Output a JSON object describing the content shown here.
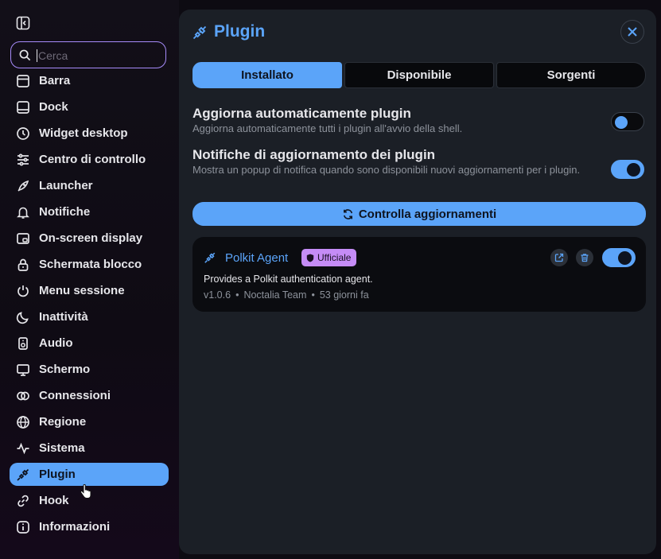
{
  "search": {
    "placeholder": "Cerca"
  },
  "sidebar": {
    "items": [
      {
        "label": "Barra"
      },
      {
        "label": "Dock"
      },
      {
        "label": "Widget desktop"
      },
      {
        "label": "Centro di controllo"
      },
      {
        "label": "Launcher"
      },
      {
        "label": "Notifiche"
      },
      {
        "label": "On-screen display"
      },
      {
        "label": "Schermata blocco"
      },
      {
        "label": "Menu sessione"
      },
      {
        "label": "Inattività"
      },
      {
        "label": "Audio"
      },
      {
        "label": "Schermo"
      },
      {
        "label": "Connessioni"
      },
      {
        "label": "Regione"
      },
      {
        "label": "Sistema"
      },
      {
        "label": "Plugin"
      },
      {
        "label": "Hook"
      },
      {
        "label": "Informazioni"
      }
    ]
  },
  "panel": {
    "title": "Plugin",
    "tabs": [
      "Installato",
      "Disponibile",
      "Sorgenti"
    ],
    "settings": [
      {
        "title": "Aggiorna automaticamente plugin",
        "description": "Aggiorna automaticamente tutti i plugin all'avvio della shell.",
        "enabled": false
      },
      {
        "title": "Notifiche di aggiornamento dei plugin",
        "description": "Mostra un popup di notifica quando sono disponibili nuovi aggiornamenti per i plugin.",
        "enabled": true
      }
    ],
    "check_button": "Controlla aggiornamenti",
    "plugin": {
      "name": "Polkit Agent",
      "badge": "Ufficiale",
      "description": "Provides a Polkit authentication agent.",
      "version": "v1.0.6",
      "author": "Noctalia Team",
      "updated": "53 giorni fa",
      "enabled": true
    }
  },
  "colors": {
    "accent": "#5ba4f9",
    "badge": "#c58cf6",
    "panel": "#1b1f26"
  }
}
